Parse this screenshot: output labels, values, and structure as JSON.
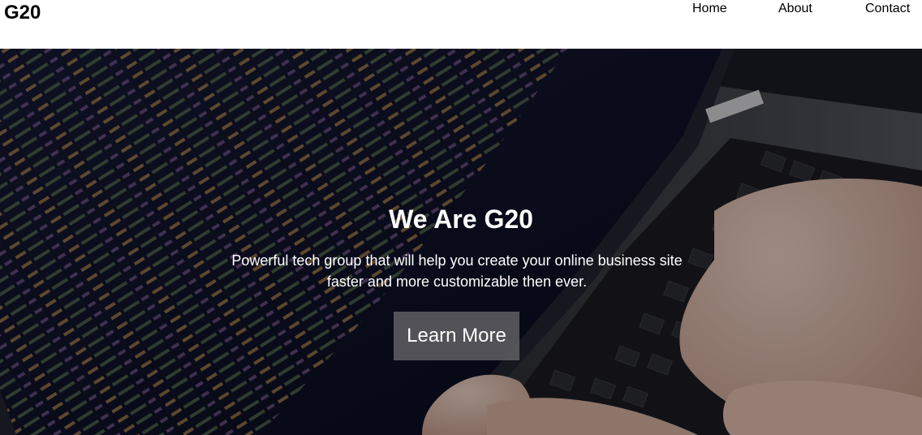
{
  "brand": {
    "logo": "G20"
  },
  "nav": {
    "home": "Home",
    "about": "About",
    "contact": "Contact"
  },
  "hero": {
    "title": "We Are G20",
    "subtitle": "Powerful tech group that will help you create your online business site faster and more customizable then ever.",
    "button_label": "Learn More"
  },
  "colors": {
    "nav_background": "#ffffff",
    "hero_overlay": "#0f1020",
    "button_background": "#5f5f64",
    "text_light": "#ffffff"
  }
}
